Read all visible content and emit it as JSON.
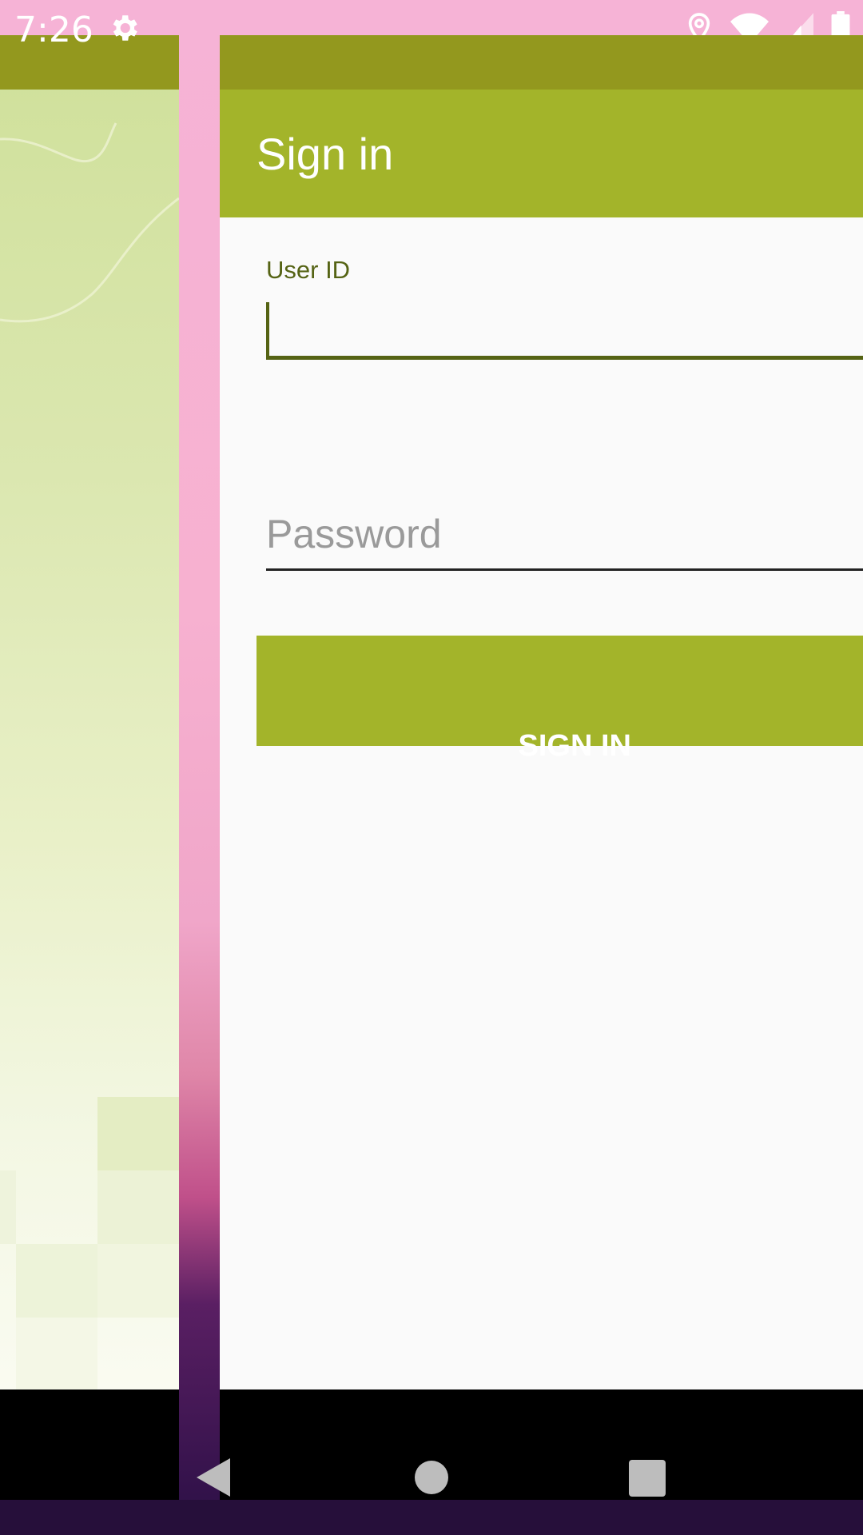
{
  "status_bar": {
    "time": "7:26",
    "icons": [
      "gear-icon",
      "location-icon",
      "wifi-icon",
      "signal-icon",
      "battery-icon"
    ]
  },
  "app": {
    "title": "Sign in",
    "user_id_label": "User ID",
    "user_id_value": "",
    "password_placeholder": "Password",
    "password_value": "",
    "sign_in_button": "SIGN IN"
  },
  "navigation": {
    "buttons": [
      "back-icon",
      "home-icon",
      "recents-icon"
    ]
  },
  "colors": {
    "toolbar": "#a3b42a",
    "status_band": "#93981e",
    "accent": "#556314",
    "background": "#fafafa"
  }
}
